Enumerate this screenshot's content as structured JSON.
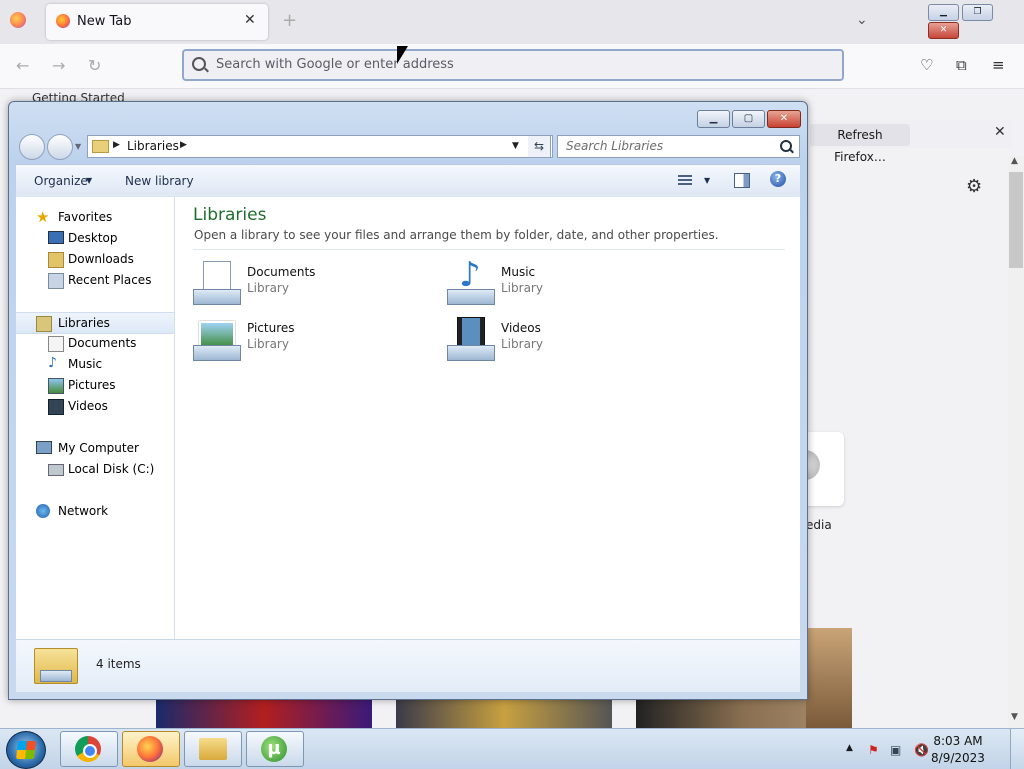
{
  "firefox": {
    "tab_title": "New Tab",
    "url_placeholder": "Search with Google or enter address",
    "bookmark": "Getting Started",
    "refresh_button": "Refresh Firefox…",
    "tile_label": "edia"
  },
  "explorer": {
    "address": {
      "crumb": "Libraries"
    },
    "search_placeholder": "Search Libraries",
    "toolbar": {
      "organize": "Organize",
      "new_library": "New library",
      "help": "?"
    },
    "nav": {
      "favorites": {
        "label": "Favorites",
        "items": [
          "Desktop",
          "Downloads",
          "Recent Places"
        ]
      },
      "libraries": {
        "label": "Libraries",
        "items": [
          "Documents",
          "Music",
          "Pictures",
          "Videos"
        ]
      },
      "computer": {
        "label": "My Computer",
        "items": [
          "Local Disk (C:)"
        ]
      },
      "network": {
        "label": "Network"
      }
    },
    "content": {
      "title": "Libraries",
      "subtitle": "Open a library to see your files and arrange them by folder, date, and other properties.",
      "libraries": [
        {
          "name": "Documents",
          "type": "Library",
          "icon": "documents-icon"
        },
        {
          "name": "Music",
          "type": "Library",
          "icon": "music-icon"
        },
        {
          "name": "Pictures",
          "type": "Library",
          "icon": "pictures-icon"
        },
        {
          "name": "Videos",
          "type": "Library",
          "icon": "videos-icon"
        }
      ]
    },
    "status": {
      "count": "4 items"
    }
  },
  "taskbar": {
    "pinned": [
      "chrome-icon",
      "firefox-icon",
      "explorer-icon",
      "utorrent-icon"
    ],
    "utorrent_glyph": "µ",
    "clock": {
      "time": "8:03 AM",
      "date": "8/9/2023"
    }
  },
  "colors": {
    "content_heading": "#1e6e2e",
    "taskbar_active": "#f3c86a"
  }
}
